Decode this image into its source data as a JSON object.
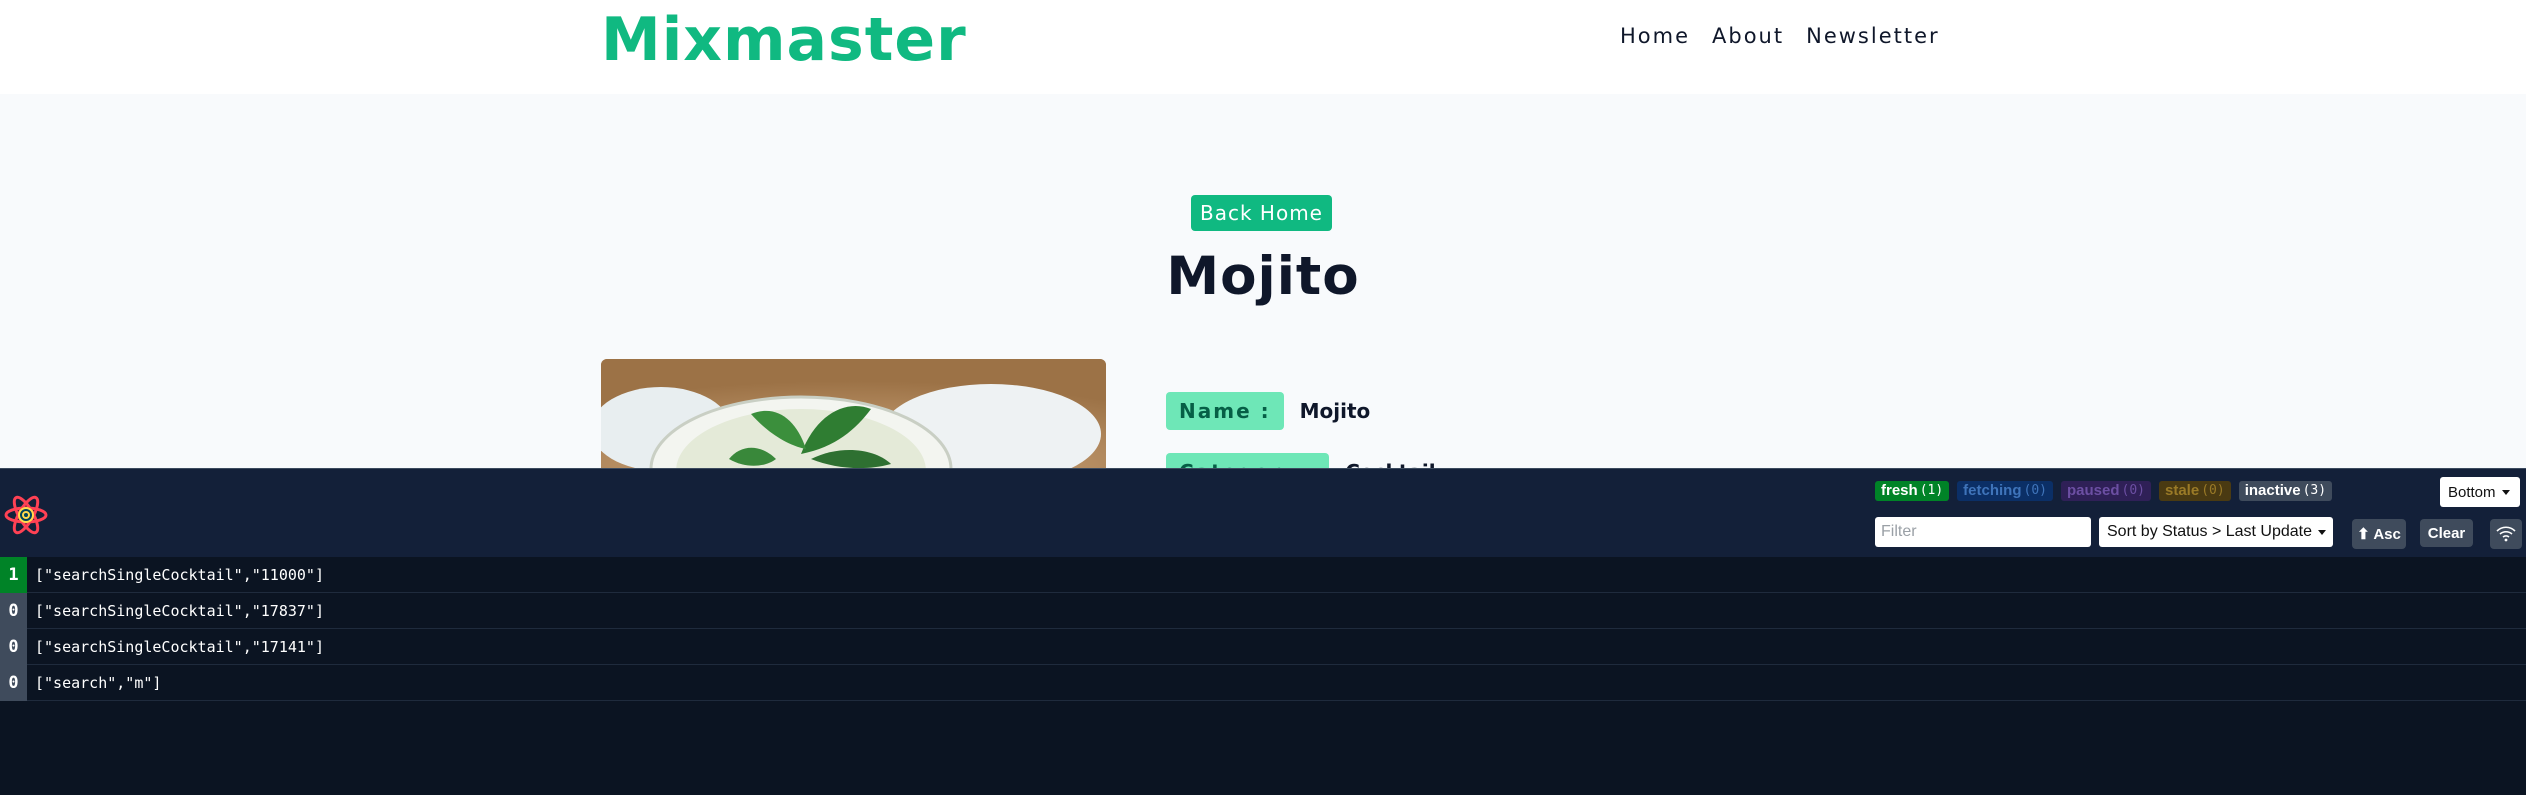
{
  "brand": {
    "logo": "Mixmaster",
    "color": "#10b981"
  },
  "nav": {
    "links": [
      "Home",
      "About",
      "Newsletter"
    ]
  },
  "page": {
    "back_button": "Back Home",
    "title": "Mojito",
    "image_alt": "mojito-photo",
    "info": [
      {
        "label": "Name :",
        "value": "Mojito"
      },
      {
        "label": "Category :",
        "value": "Cocktail"
      }
    ]
  },
  "devtools": {
    "badges": [
      {
        "label": "fresh",
        "count": "(1)"
      },
      {
        "label": "fetching",
        "count": "(0)"
      },
      {
        "label": "paused",
        "count": "(0)"
      },
      {
        "label": "stale",
        "count": "(0)"
      },
      {
        "label": "inactive",
        "count": "(3)"
      }
    ],
    "position_select": "Bottom",
    "filter_placeholder": "Filter",
    "sort_select": "Sort by Status > Last Update",
    "asc_button": "⬆ Asc",
    "clear_button": "Clear",
    "queries": [
      {
        "count": "1",
        "key": "[\"searchSingleCocktail\",\"11000\"]",
        "status": "active"
      },
      {
        "count": "0",
        "key": "[\"searchSingleCocktail\",\"17837\"]",
        "status": "inactive"
      },
      {
        "count": "0",
        "key": "[\"searchSingleCocktail\",\"17141\"]",
        "status": "inactive"
      },
      {
        "count": "0",
        "key": "[\"search\",\"m\"]",
        "status": "inactive"
      }
    ]
  },
  "colors": {
    "accent": "#10b981",
    "devtools_bg": "#0b1422",
    "fresh": "#008327"
  }
}
